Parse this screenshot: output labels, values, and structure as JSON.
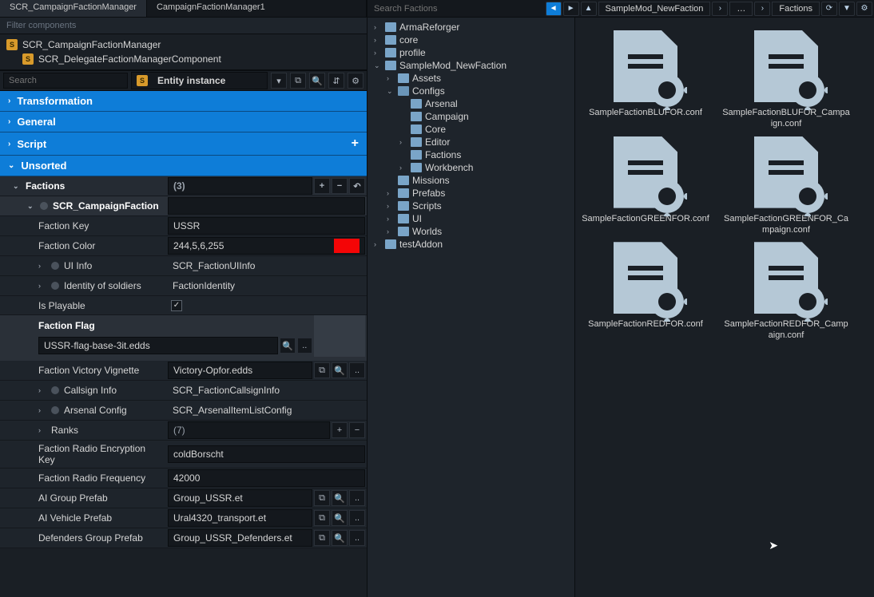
{
  "left": {
    "tab1": "SCR_CampaignFactionManager",
    "tab2": "CampaignFactionManager1",
    "filter": "Filter components",
    "components": [
      "SCR_CampaignFactionManager",
      "SCR_DelegateFactionManagerComponent"
    ],
    "searchLabel": "Search",
    "entityInstance": "Entity instance",
    "sections": {
      "transformation": "Transformation",
      "general": "General",
      "script": "Script",
      "unsorted": "Unsorted"
    },
    "factions": {
      "label": "Factions",
      "count": "(3)",
      "item": "SCR_CampaignFaction",
      "props": {
        "factionKey": {
          "label": "Faction Key",
          "value": "USSR"
        },
        "factionColor": {
          "label": "Faction Color",
          "value": "244,5,6,255",
          "hex": "#f40506"
        },
        "uiInfo": {
          "label": "UI Info",
          "value": "SCR_FactionUIInfo"
        },
        "identity": {
          "label": "Identity of soldiers",
          "value": "FactionIdentity"
        },
        "playable": {
          "label": "Is Playable",
          "checked": true
        },
        "flag": {
          "label": "Faction Flag",
          "value": "USSR-flag-base-3it.edds"
        },
        "vignette": {
          "label": "Faction Victory Vignette",
          "value": "Victory-Opfor.edds"
        },
        "callsign": {
          "label": "Callsign Info",
          "value": "SCR_FactionCallsignInfo"
        },
        "arsenal": {
          "label": "Arsenal Config",
          "value": "SCR_ArsenalItemListConfig"
        },
        "ranks": {
          "label": "Ranks",
          "value": "(7)"
        },
        "radioKey": {
          "label": "Faction Radio Encryption Key",
          "value": "coldBorscht"
        },
        "radioFreq": {
          "label": "Faction Radio Frequency",
          "value": "42000"
        },
        "aiGroup": {
          "label": "AI Group Prefab",
          "value": "Group_USSR.et"
        },
        "aiVehicle": {
          "label": "AI Vehicle Prefab",
          "value": "Ural4320_transport.et"
        },
        "defenders": {
          "label": "Defenders Group Prefab",
          "value": "Group_USSR_Defenders.et"
        }
      }
    }
  },
  "right": {
    "search": "Search Factions",
    "crumb1": "SampleMod_NewFaction",
    "crumbSep": "…",
    "crumb2": "Factions",
    "tree": [
      {
        "d": 0,
        "exp": "›",
        "name": "ArmaReforger",
        "ico": "folder"
      },
      {
        "d": 0,
        "exp": "›",
        "name": "core",
        "ico": "file"
      },
      {
        "d": 0,
        "exp": "›",
        "name": "profile",
        "ico": "folder"
      },
      {
        "d": 0,
        "exp": "⌄",
        "name": "SampleMod_NewFaction",
        "ico": "folder"
      },
      {
        "d": 1,
        "exp": "›",
        "name": "Assets",
        "ico": "folder"
      },
      {
        "d": 1,
        "exp": "⌄",
        "name": "Configs",
        "ico": "folderopen"
      },
      {
        "d": 2,
        "exp": "",
        "name": "Arsenal",
        "ico": "folder"
      },
      {
        "d": 2,
        "exp": "",
        "name": "Campaign",
        "ico": "folder"
      },
      {
        "d": 2,
        "exp": "",
        "name": "Core",
        "ico": "folder"
      },
      {
        "d": 2,
        "exp": "›",
        "name": "Editor",
        "ico": "folder"
      },
      {
        "d": 2,
        "exp": "",
        "name": "Factions",
        "ico": "folder"
      },
      {
        "d": 2,
        "exp": "›",
        "name": "Workbench",
        "ico": "folder"
      },
      {
        "d": 1,
        "exp": "",
        "name": "Missions",
        "ico": "folder"
      },
      {
        "d": 1,
        "exp": "›",
        "name": "Prefabs",
        "ico": "folder"
      },
      {
        "d": 1,
        "exp": "›",
        "name": "Scripts",
        "ico": "folder"
      },
      {
        "d": 1,
        "exp": "›",
        "name": "UI",
        "ico": "folder"
      },
      {
        "d": 1,
        "exp": "›",
        "name": "Worlds",
        "ico": "folder"
      },
      {
        "d": 0,
        "exp": "›",
        "name": "testAddon",
        "ico": "folder"
      }
    ],
    "files": [
      "SampleFactionBLUFOR.conf",
      "SampleFactionBLUFOR_Campaign.conf",
      "SampleFactionGREENFOR.conf",
      "SampleFactionGREENFOR_Campaign.conf",
      "SampleFactionREDFOR.conf",
      "SampleFactionREDFOR_Campaign.conf"
    ]
  }
}
